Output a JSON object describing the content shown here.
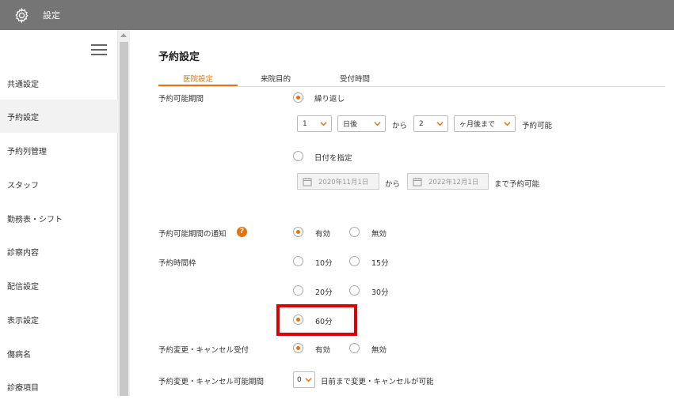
{
  "header": {
    "title": "設定"
  },
  "sidebar": {
    "items": [
      {
        "label": "共通設定"
      },
      {
        "label": "予約設定"
      },
      {
        "label": "予約列管理"
      },
      {
        "label": "スタッフ"
      },
      {
        "label": "勤務表・シフト"
      },
      {
        "label": "診察内容"
      },
      {
        "label": "配信設定"
      },
      {
        "label": "表示設定"
      },
      {
        "label": "傷病名"
      },
      {
        "label": "診療項目"
      }
    ],
    "active_index": 1
  },
  "main": {
    "title": "予約設定",
    "tabs": [
      {
        "label": "医院設定",
        "active": true
      },
      {
        "label": "来院目的",
        "active": false
      },
      {
        "label": "受付時間",
        "active": false
      }
    ],
    "period": {
      "label": "予約可能期間",
      "repeat_label": "繰り返し",
      "select1": "1",
      "select2": "日後",
      "from": "から",
      "select3": "2",
      "select4": "ヶ月後まで",
      "available": "予約可能",
      "specify_label": "日付を指定",
      "date_from": "2020年11月1日",
      "from2": "から",
      "date_to": "2022年12月1日",
      "until_available": "まで予約可能"
    },
    "notify": {
      "label": "予約可能期間の通知",
      "help": "?",
      "on": "有効",
      "off": "無効"
    },
    "timeslot": {
      "label": "予約時間枠",
      "opt10": "10分",
      "opt15": "15分",
      "opt20": "20分",
      "opt30": "30分",
      "opt60": "60分"
    },
    "change": {
      "label": "予約変更・キャンセル受付",
      "on": "有効",
      "off": "無効"
    },
    "change_period": {
      "label": "予約変更・キャンセル可能期間",
      "select": "0",
      "suffix": "日前まで変更・キャンセルが可能"
    }
  }
}
